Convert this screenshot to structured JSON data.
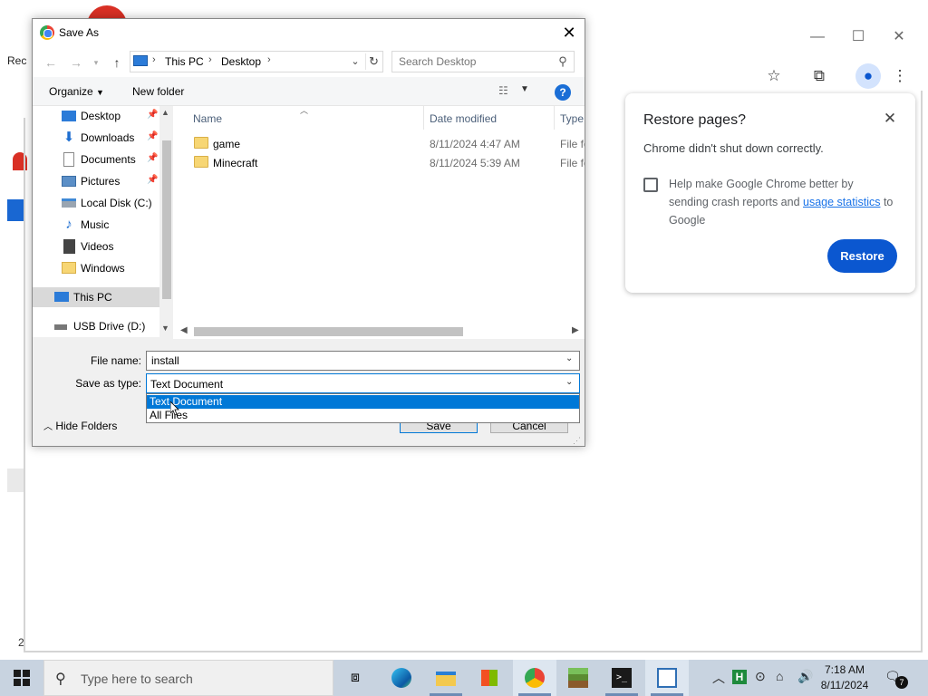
{
  "dialog": {
    "title": "Save As",
    "close_glyph": "✕",
    "breadcrumb": [
      "This PC",
      "Desktop"
    ],
    "search_placeholder": "Search Desktop",
    "organize_label": "Organize",
    "new_folder_label": "New folder",
    "help_label": "?",
    "nav_items": [
      {
        "label": "Desktop",
        "icon": "desktop-icon",
        "pinned": true
      },
      {
        "label": "Downloads",
        "icon": "download-icon",
        "pinned": true
      },
      {
        "label": "Documents",
        "icon": "documents-icon",
        "pinned": true
      },
      {
        "label": "Pictures",
        "icon": "pictures-icon",
        "pinned": true
      },
      {
        "label": "Local Disk (C:)",
        "icon": "disk-icon",
        "pinned": false
      },
      {
        "label": "Music",
        "icon": "music-icon",
        "pinned": false
      },
      {
        "label": "Videos",
        "icon": "videos-icon",
        "pinned": false
      },
      {
        "label": "Windows",
        "icon": "folder-icon",
        "pinned": false
      },
      {
        "label": "This PC",
        "icon": "pc-icon",
        "pinned": false
      },
      {
        "label": "USB Drive (D:)",
        "icon": "usb-drive-icon",
        "pinned": false
      }
    ],
    "columns": [
      "Name",
      "Date modified",
      "Type"
    ],
    "files": [
      {
        "name": "game",
        "date": "8/11/2024 4:47 AM",
        "type": "File fo"
      },
      {
        "name": "Minecraft",
        "date": "8/11/2024 5:39 AM",
        "type": "File fo"
      }
    ],
    "file_name_label": "File name:",
    "file_name_value": "install",
    "save_type_label": "Save as type:",
    "save_type_value": "Text Document",
    "save_type_options": [
      "Text Document",
      "All Files"
    ],
    "hide_folders_label": "Hide Folders",
    "save_label": "Save",
    "cancel_label": "Cancel"
  },
  "restore_popup": {
    "title": "Restore pages?",
    "message": "Chrome didn't shut down correctly.",
    "help_text_before": "Help make Google Chrome better by sending crash reports and ",
    "help_link": "usage statistics",
    "help_text_after": " to Google",
    "restore_label": "Restore",
    "accent": "#0b57d0"
  },
  "chrome": {
    "side_label": "Rec",
    "bottom_digit": "2"
  },
  "taskbar": {
    "search_placeholder": "Type here to search",
    "time": "7:18 AM",
    "date": "8/11/2024",
    "notification_count": "7",
    "tray_letter": "H"
  }
}
